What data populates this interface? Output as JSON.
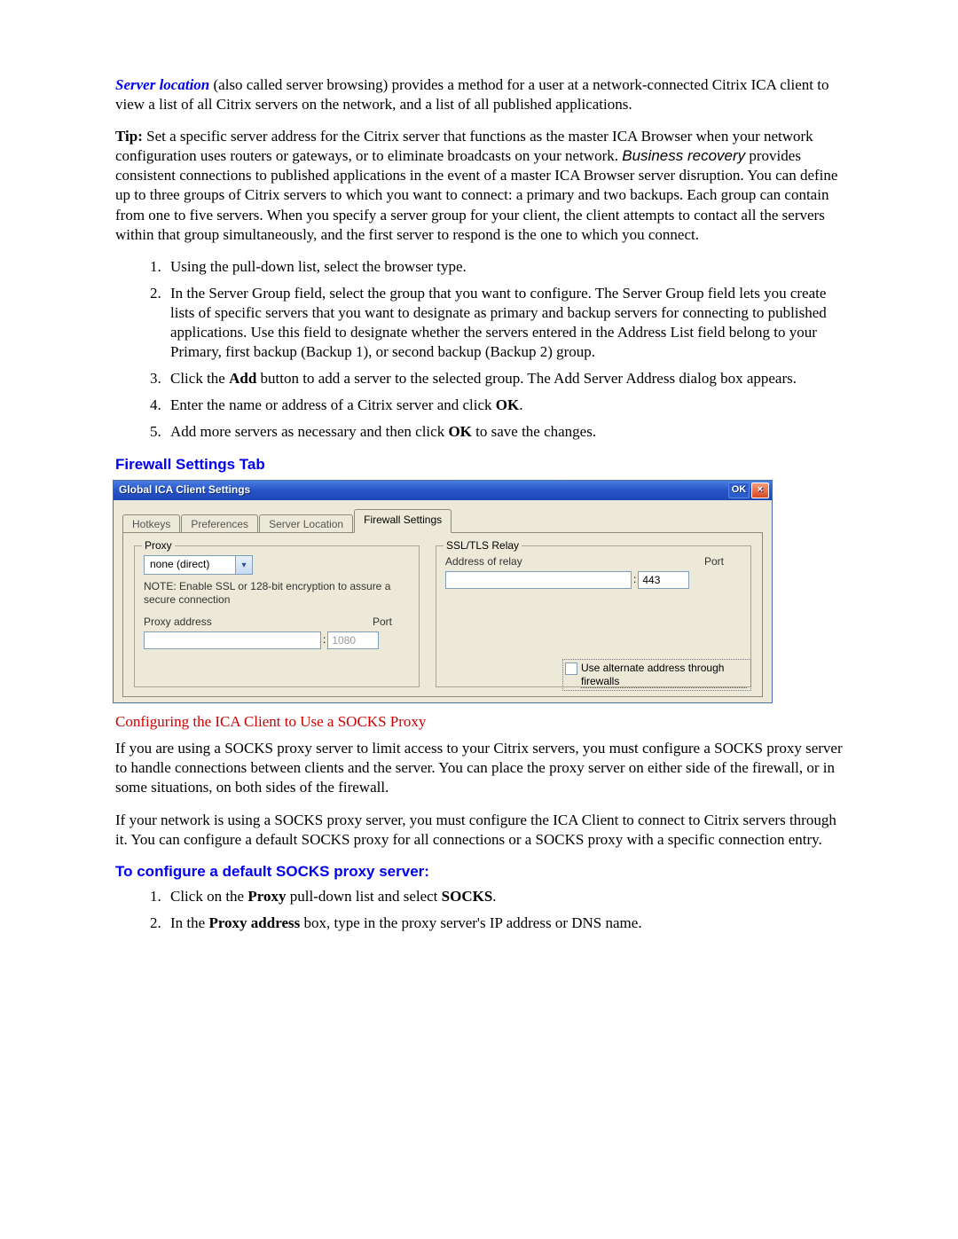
{
  "intro": {
    "server_location_label": "Server location",
    "server_location_rest": " (also called server browsing) provides a method for a user at a network-connected Citrix ICA client to view a list of all Citrix servers on the network, and a list of all published applications."
  },
  "tip": {
    "prefix": "Tip:",
    "body_a": " Set a specific server address for the Citrix server that functions as the master ICA Browser when your network configuration uses routers or gateways, or to eliminate broadcasts on your network. ",
    "biz_recovery": "Business recovery",
    "body_b": " provides consistent connections to published applications in the event of a master ICA Browser server disruption. You can define up to three groups of Citrix servers to which you want to connect: a primary and two backups. Each group can contain from one to five servers. When you specify a server group for your client, the client attempts to contact all the servers within that group simultaneously, and the first server to respond is the one to which you connect."
  },
  "steps_a": [
    "Using the pull-down list, select the browser type.",
    "In the Server Group field, select the group that you want to configure. The Server Group field lets you create lists of specific servers that you want to designate as primary and backup servers for connecting to published applications. Use this field to designate whether the servers entered in the Address List field belong to your Primary, first backup (Backup 1), or second backup (Backup 2) group."
  ],
  "step3": {
    "a": "Click the ",
    "b": "Add",
    "c": " button to add a server to the selected group.  The Add Server Address dialog box appears."
  },
  "step4": {
    "a": "Enter the name or address of a Citrix server and click ",
    "b": "OK",
    "c": "."
  },
  "step5": {
    "a": "Add more servers as necessary and then click ",
    "b": "OK",
    "c": " to save the changes."
  },
  "heading_firewall_tab": "Firewall Settings Tab",
  "window": {
    "title": "Global ICA Client Settings",
    "ok": "OK",
    "close": "×",
    "tabs": [
      "Hotkeys",
      "Preferences",
      "Server Location",
      "Firewall Settings"
    ],
    "proxy": {
      "legend": "Proxy",
      "combo_value": "none (direct)",
      "note": "NOTE: Enable SSL or 128-bit encryption to assure a secure connection",
      "addr_label": "Proxy address",
      "port_label": "Port",
      "addr_value": "",
      "port_value": "1080"
    },
    "ssl": {
      "legend": "SSL/TLS Relay",
      "addr_label": "Address of relay",
      "port_label": "Port",
      "addr_value": "",
      "port_value": "443"
    },
    "alt_addr_label": "Use alternate address through firewalls"
  },
  "heading_socks": "Configuring the ICA Client to Use a SOCKS Proxy",
  "socks_p1": "If you are using a SOCKS proxy server to limit access to your Citrix servers, you must configure a SOCKS proxy server to handle connections between clients and the server. You can place the proxy server on either side of the firewall, or in some situations, on both sides of the firewall.",
  "socks_p2": "If your network is using a SOCKS proxy server, you must configure the ICA Client to connect to Citrix servers through it. You can configure a default SOCKS proxy for all connections or a SOCKS proxy with a specific connection entry.",
  "heading_configure_default": "To configure a default SOCKS proxy server:",
  "socks_step1": {
    "a": "Click on the ",
    "b": "Proxy",
    "c": " pull-down list and select ",
    "d": "SOCKS",
    "e": "."
  },
  "socks_step2": {
    "a": "In the ",
    "b": "Proxy address",
    "c": " box, type in the proxy server's IP address or DNS name."
  }
}
